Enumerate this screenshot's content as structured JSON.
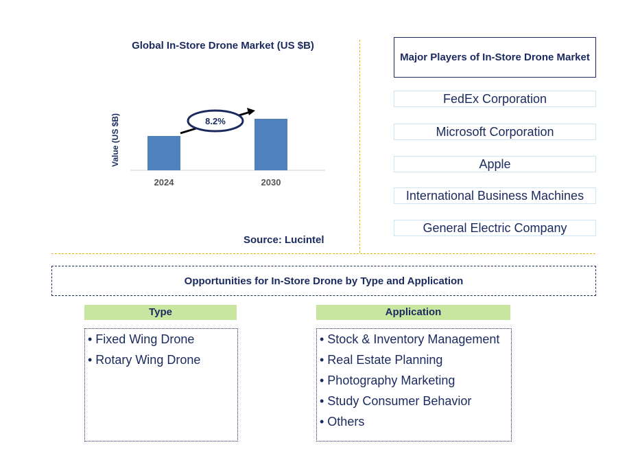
{
  "chart_data": {
    "type": "bar",
    "title": "Global In-Store Drone Market (US $B)",
    "ylabel": "Value (US $B)",
    "xlabel": "",
    "categories": [
      "2024",
      "2030"
    ],
    "values": [
      1.0,
      1.5
    ],
    "color": "#4f81bd",
    "annotation": "8.2%",
    "grid": false
  },
  "source": "Source: Lucintel",
  "players": {
    "title": "Major Players of In-Store Drone Market",
    "items": [
      "FedEx Corporation",
      "Microsoft Corporation",
      "Apple",
      "International Business Machines",
      "General Electric Company"
    ]
  },
  "opportunities": {
    "title": "Opportunities for In-Store Drone by Type and Application",
    "type": {
      "header": "Type",
      "items": [
        "• Fixed Wing Drone",
        "• Rotary Wing Drone"
      ]
    },
    "application": {
      "header": "Application",
      "items": [
        "• Stock & Inventory Management",
        "• Real Estate Planning",
        "• Photography Marketing",
        "• Study Consumer Behavior",
        "• Others"
      ]
    }
  }
}
